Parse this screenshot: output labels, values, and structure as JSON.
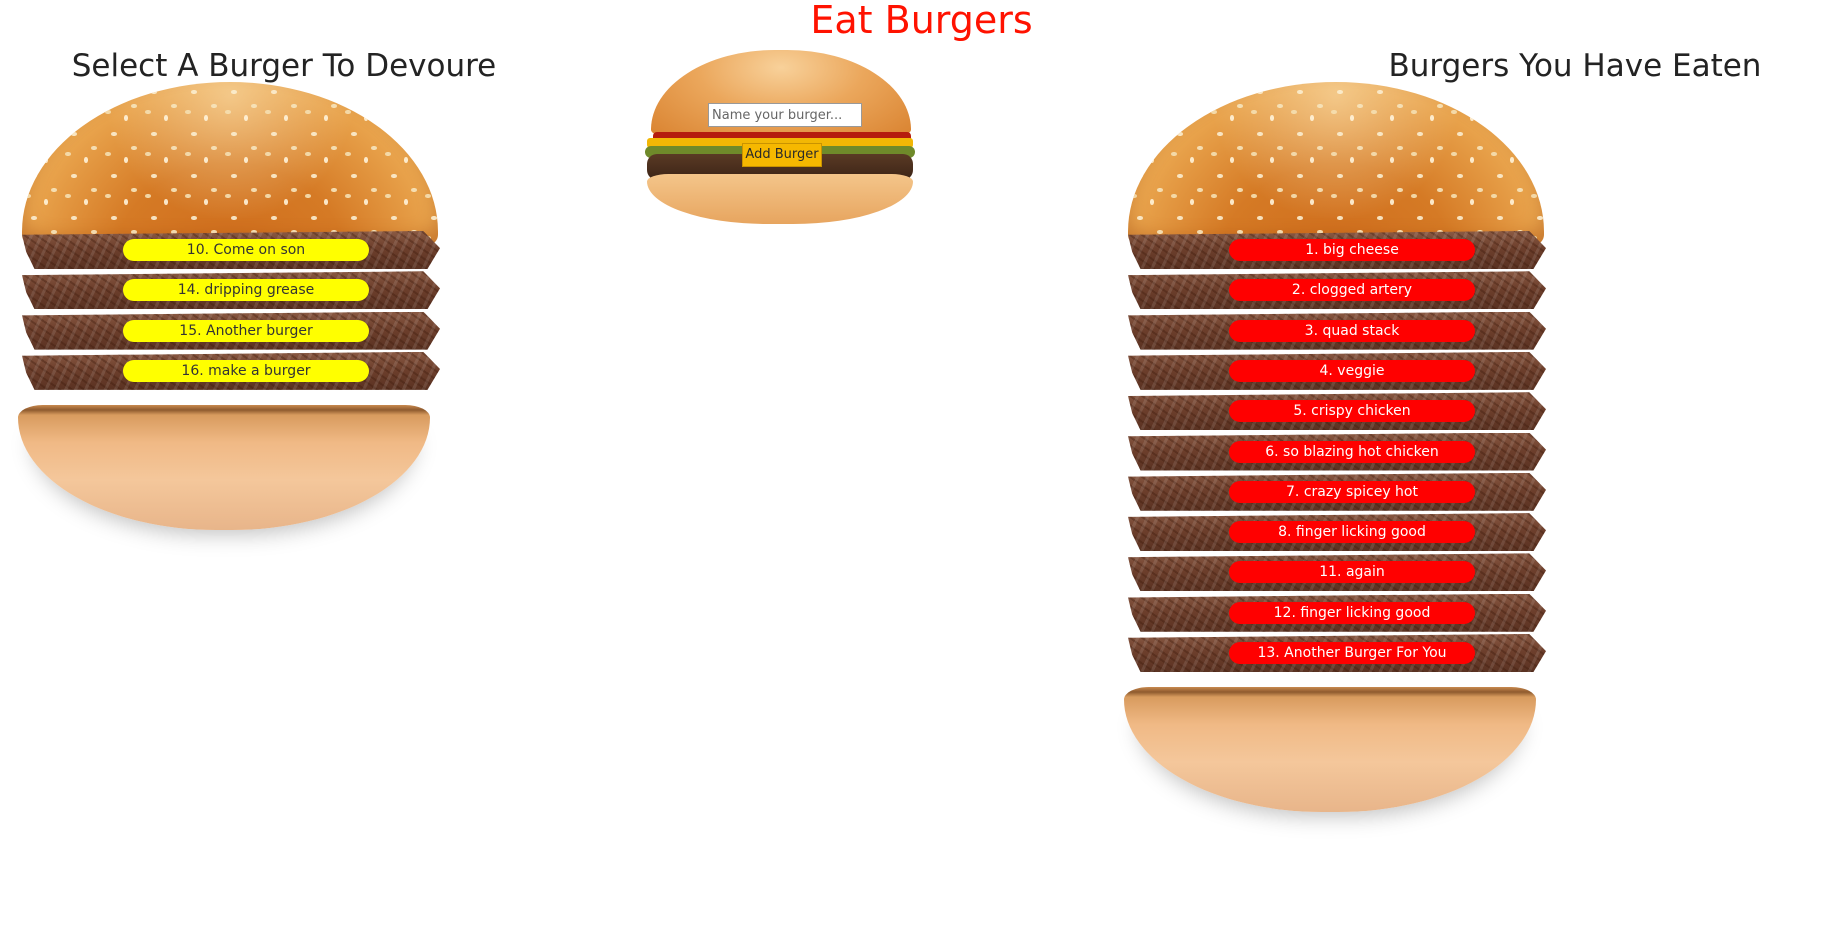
{
  "page": {
    "title": "Eat Burgers"
  },
  "add_form": {
    "input_placeholder": "Name your burger...",
    "input_value": "",
    "button_label": "Add Burger"
  },
  "devour_column": {
    "heading": "Select A Burger To Devoure",
    "button_color": "#ffff00",
    "burgers": [
      {
        "label": "10. Come on son"
      },
      {
        "label": "14. dripping grease"
      },
      {
        "label": "15. Another burger"
      },
      {
        "label": "16. make a burger"
      }
    ]
  },
  "eaten_column": {
    "heading": "Burgers You Have Eaten",
    "button_color": "#ff0000",
    "burgers": [
      {
        "label": "1. big cheese"
      },
      {
        "label": "2. clogged artery"
      },
      {
        "label": "3. quad stack"
      },
      {
        "label": "4. veggie"
      },
      {
        "label": "5. crispy chicken"
      },
      {
        "label": "6. so blazing hot chicken"
      },
      {
        "label": "7. crazy spicey hot"
      },
      {
        "label": "8. finger licking good"
      },
      {
        "label": "11. again"
      },
      {
        "label": "12. finger licking good"
      },
      {
        "label": "13. Another Burger For You"
      }
    ]
  },
  "colors": {
    "title": "#ff1200",
    "heading": "#232323",
    "add_button": "#f6b800"
  }
}
